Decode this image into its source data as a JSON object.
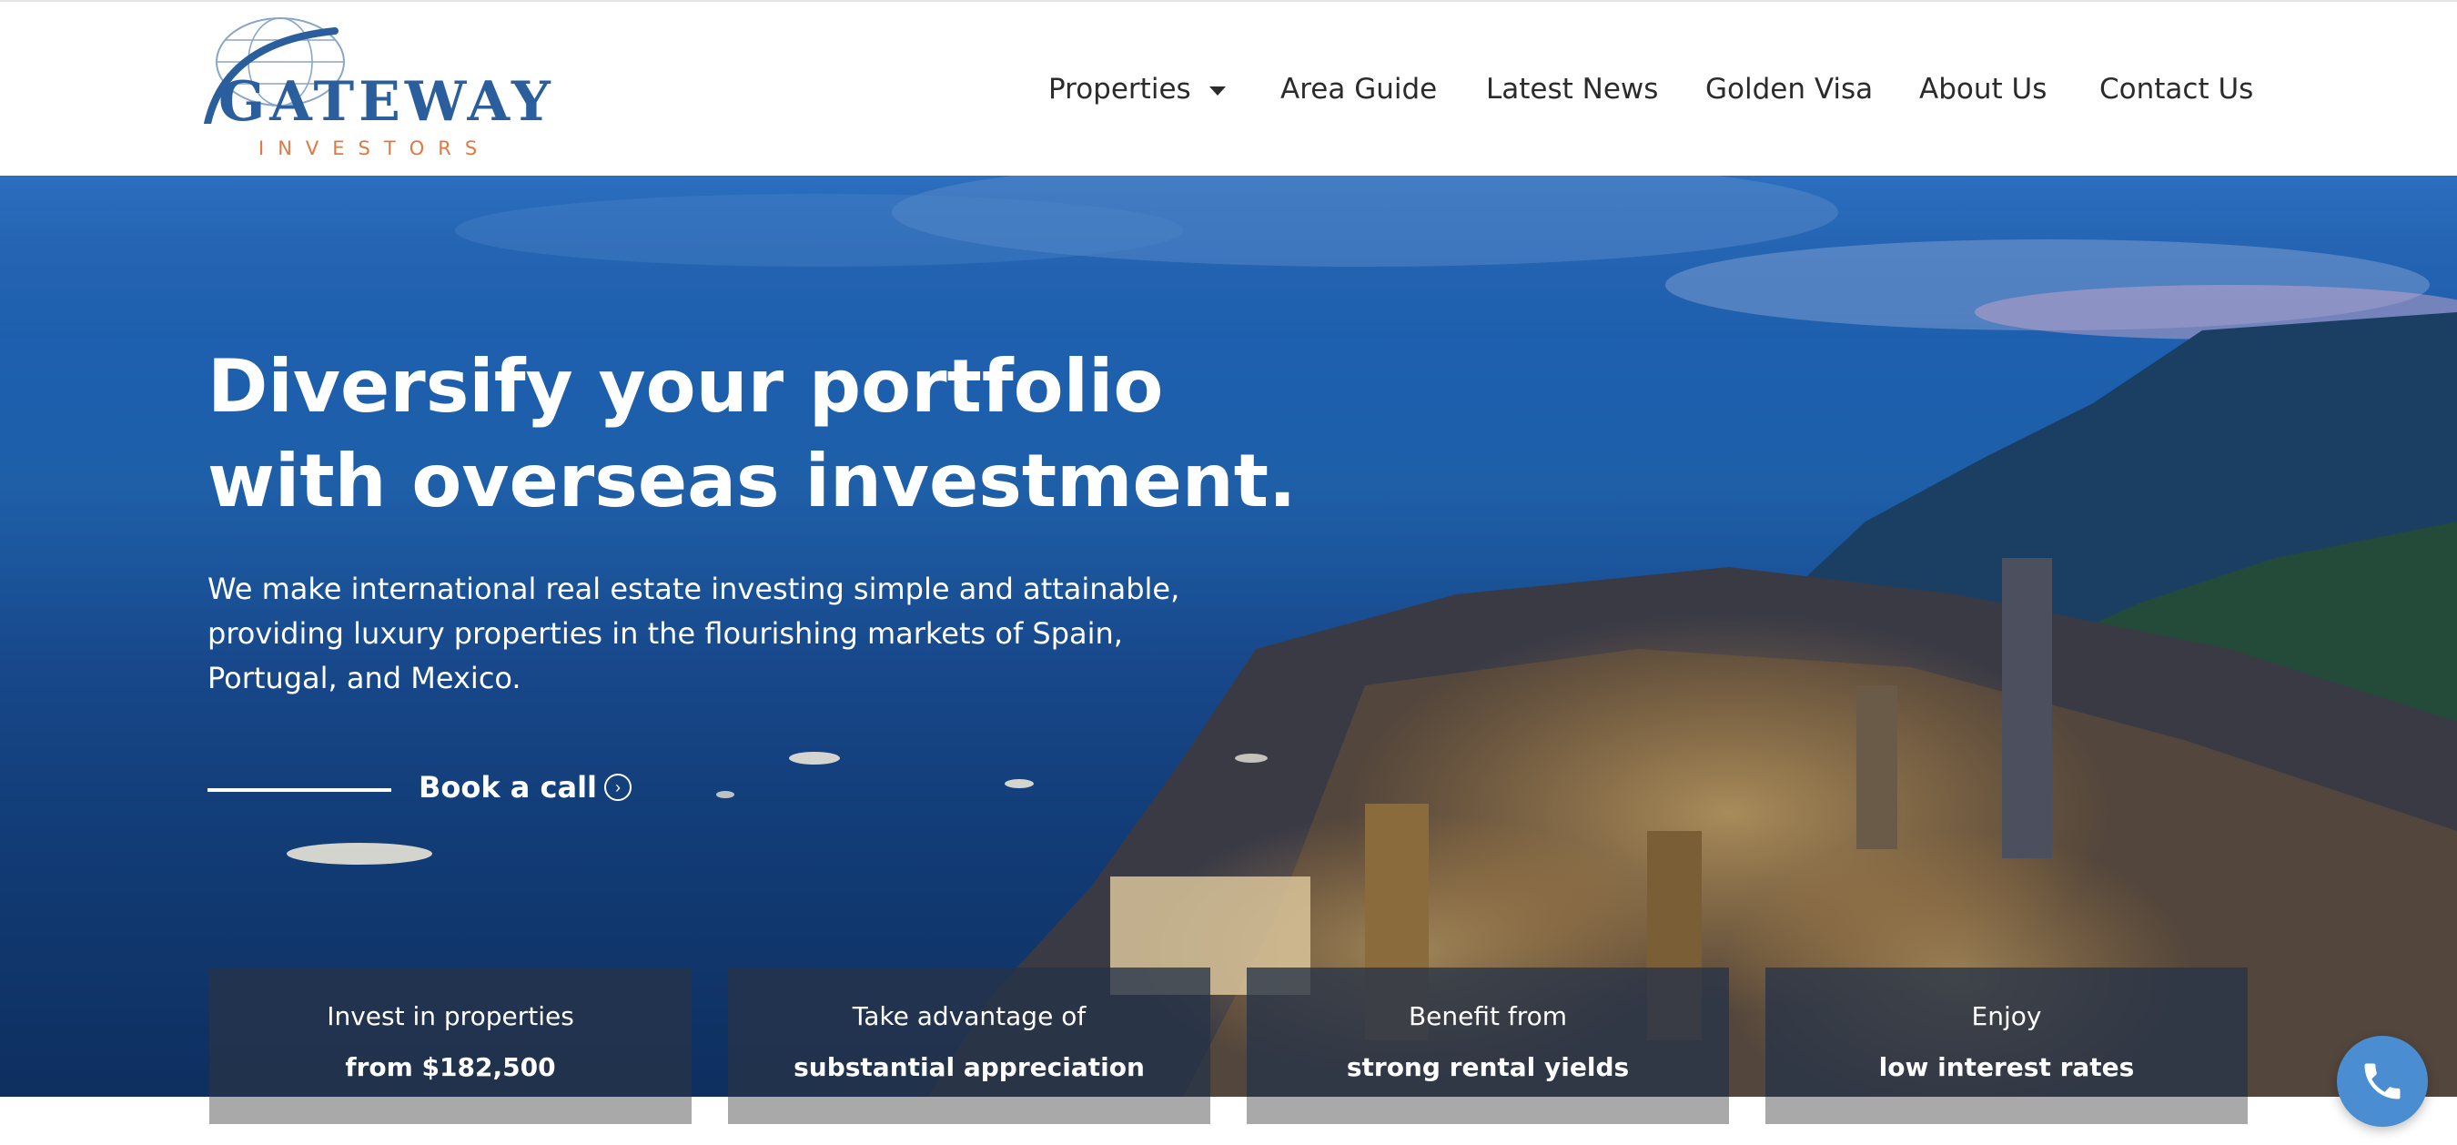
{
  "logo": {
    "wordmark": "GATEWAY",
    "subline": "INVESTORS",
    "icon": "globe-arc-icon"
  },
  "nav": {
    "items": [
      {
        "label": "Properties",
        "has_dropdown": true
      },
      {
        "label": "Area Guide"
      },
      {
        "label": "Latest News"
      },
      {
        "label": "Golden Visa"
      },
      {
        "label": "About Us"
      },
      {
        "label": "Contact Us"
      }
    ],
    "dropdown_icon": "caret-down-icon"
  },
  "hero": {
    "headline": "Diversify your portfolio with overseas investment.",
    "lead": "We make international real estate investing simple and attainable, providing luxury properties in the flourishing markets of Spain, Portugal, and Mexico.",
    "cta_label": "Book a call",
    "cta_icon": "chevron-right-circle-icon",
    "background": "night-city-coastline-photo"
  },
  "cards": [
    {
      "line1": "Invest in properties",
      "line2": "from $182,500"
    },
    {
      "line1": "Take advantage of",
      "line2": "substantial appreciation"
    },
    {
      "line1": "Benefit from",
      "line2": "strong rental yields"
    },
    {
      "line1": "Enjoy",
      "line2": "low interest rates"
    }
  ],
  "call_button": {
    "icon": "phone-icon"
  },
  "colors": {
    "brand_blue": "#2a5e9c",
    "brand_orange": "#e0783f",
    "nav_text": "#2b2b2b",
    "card_bg": "#273348",
    "call_button": "#4a8ed1"
  }
}
